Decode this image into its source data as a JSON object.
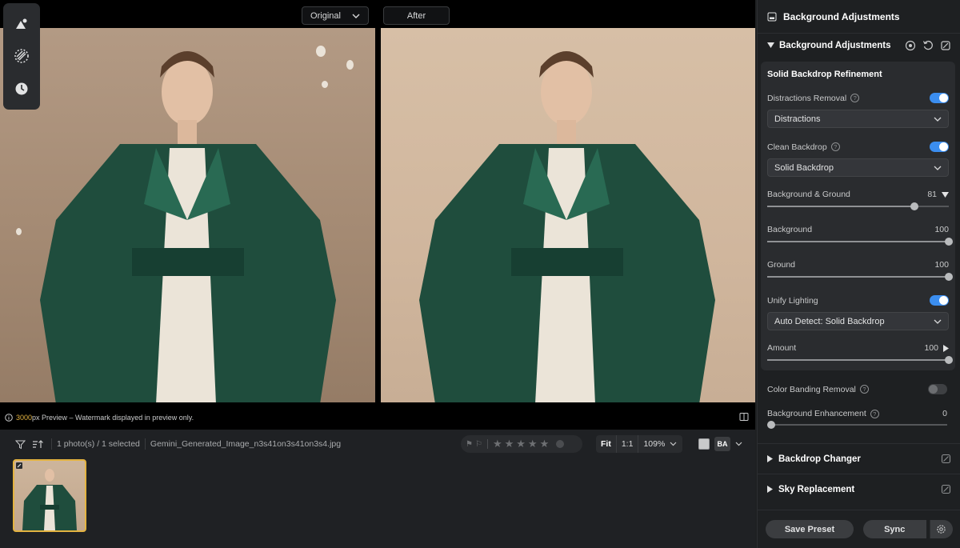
{
  "viewer": {
    "original_label": "Original",
    "after_label": "After",
    "tools": [
      "adjust-icon",
      "mask-icon",
      "history-icon"
    ],
    "preview": {
      "px_value": "3000",
      "text": "px Preview – Watermark displayed in preview only."
    }
  },
  "filmstrip": {
    "photo_count": "1 photo(s) / 1 selected",
    "filename": "Gemini_Generated_Image_n3s41on3s41on3s4.jpg",
    "zoom": {
      "fit": "Fit",
      "one_to_one": "1:1",
      "percent": "109%"
    },
    "ba_label": "BA"
  },
  "panel": {
    "header_title": "Background Adjustments",
    "section_title": "Background Adjustments",
    "card_title": "Solid Backdrop Refinement",
    "distractions_removal": {
      "label": "Distractions Removal",
      "enabled": true,
      "option": "Distractions"
    },
    "clean_backdrop": {
      "label": "Clean Backdrop",
      "enabled": true,
      "option": "Solid Backdrop"
    },
    "background_ground": {
      "label": "Background & Ground",
      "value": "81"
    },
    "background": {
      "label": "Background",
      "value": "100"
    },
    "ground": {
      "label": "Ground",
      "value": "100"
    },
    "unify_lighting": {
      "label": "Unify Lighting",
      "enabled": true,
      "option": "Auto Detect: Solid Backdrop"
    },
    "amount": {
      "label": "Amount",
      "value": "100"
    },
    "color_banding": {
      "label": "Color Banding Removal",
      "enabled": false
    },
    "bg_enhancement": {
      "label": "Background Enhancement",
      "value": "0"
    },
    "backdrop_changer": "Backdrop Changer",
    "sky_replacement": "Sky Replacement",
    "save_preset": "Save Preset",
    "sync": "Sync"
  },
  "colors": {
    "accent": "#3b8ef0",
    "highlight": "#e3b341"
  }
}
